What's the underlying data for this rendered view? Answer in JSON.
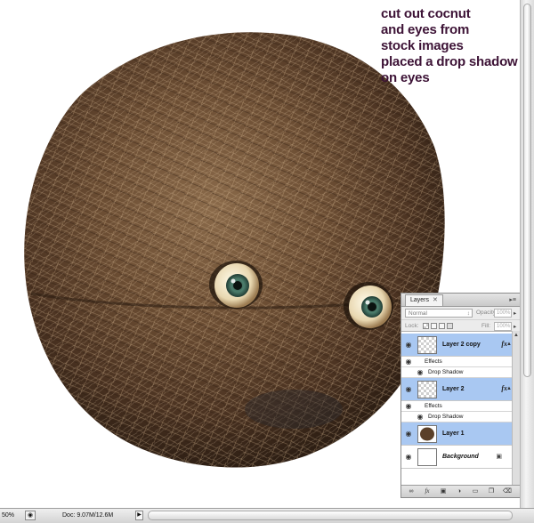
{
  "annotation": {
    "lines": [
      "cut out cocnut",
      "and eyes from",
      "stock images",
      "placed a drop shadow",
      "on eyes"
    ],
    "color": "#3d1336"
  },
  "image": {
    "subject": "coconut-with-eyes"
  },
  "layers_panel": {
    "tab_label": "Layers",
    "tab_close": "✕",
    "menu_icon": "▸≡",
    "blend_mode": "Normal",
    "opacity_label": "Opacity:",
    "opacity_value": "100%",
    "lock_label": "Lock:",
    "fill_label": "Fill:",
    "fill_value": "100%",
    "fx_symbol": "fx",
    "layers": [
      {
        "name": "Layer 2 copy",
        "effects_label": "Effects",
        "effect": "Drop Shadow",
        "selected": true
      },
      {
        "name": "Layer 2",
        "effects_label": "Effects",
        "effect": "Drop Shadow",
        "selected": true
      },
      {
        "name": "Layer 1",
        "selected": true
      },
      {
        "name": "Background",
        "selected": false,
        "locked": true
      }
    ],
    "footer_icons": [
      "link-icon",
      "fx-icon",
      "mask-icon",
      "adjustment-icon",
      "group-icon",
      "new-layer-icon",
      "trash-icon"
    ]
  },
  "statusbar": {
    "zoom": "50%",
    "doc": "Doc: 9.07M/12.6M"
  },
  "colors": {
    "selection": "#a9c8f2",
    "panel_bg": "#ececec"
  }
}
